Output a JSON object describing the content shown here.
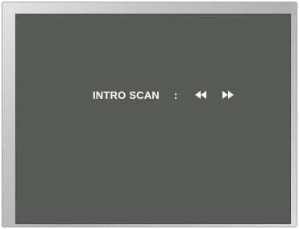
{
  "osd": {
    "label": "INTRO SCAN",
    "separator": ":",
    "rewind_icon": "rewind-icon",
    "fast_forward_icon": "fast-forward-icon"
  },
  "colors": {
    "screen_background": "#585a58",
    "text": "#ffffff",
    "bezel": "#c4c4c4"
  }
}
